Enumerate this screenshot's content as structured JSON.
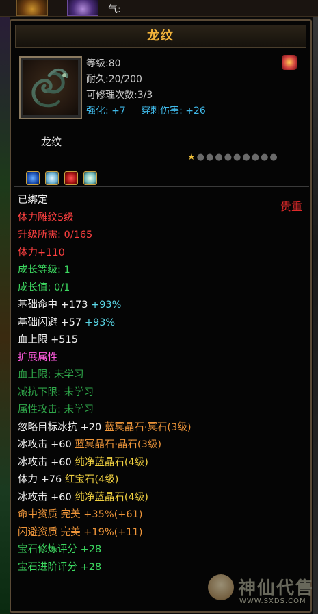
{
  "top": {
    "qi_label": "气:"
  },
  "item": {
    "title": "龙纹",
    "subname": "龙纹",
    "level": "等级:80",
    "durability": "耐久:20/200",
    "repairs": "可修理次数:3/3",
    "enhance_label": "强化:",
    "enhance_value": "+7",
    "pierce_label": "穿刺伤害:",
    "pierce_value": "+26",
    "stars_filled": 1,
    "stars_total": 10,
    "weight": "贵重",
    "gems": [
      "blue-gem-icon",
      "white-gem-icon",
      "red-gem-icon",
      "white-gem-icon"
    ]
  },
  "attributes": [
    {
      "text": "已绑定",
      "color": "white"
    },
    {
      "text": "体力雕纹5级",
      "color": "red"
    },
    {
      "text": "升级所需: 0/165",
      "color": "red"
    },
    {
      "text": "体力+110",
      "color": "red"
    },
    {
      "text": "成长等级: 1",
      "color": "green"
    },
    {
      "text": "成长值: 0/1",
      "color": "green"
    },
    {
      "text": "基础命中 +173",
      "extra": "+93%",
      "color": "white",
      "extra_color": "cyan"
    },
    {
      "text": "基础闪避 +57",
      "extra": "+93%",
      "color": "white",
      "extra_color": "cyan"
    },
    {
      "text": "血上限 +515",
      "color": "white"
    },
    {
      "text": "扩展属性",
      "color": "pink"
    },
    {
      "text": "血上限: 未学习",
      "color": "dgreen"
    },
    {
      "text": "减抗下限: 未学习",
      "color": "dgreen"
    },
    {
      "text": "属性攻击: 未学习",
      "color": "dgreen"
    },
    {
      "text": "忽略目标冰抗 +20",
      "extra": "蓝冥晶石·冥石(3级)",
      "color": "white",
      "extra_color": "orange"
    },
    {
      "text": "冰攻击 +60",
      "extra": "蓝冥晶石·晶石(3级)",
      "color": "white",
      "extra_color": "orange"
    },
    {
      "text": "冰攻击 +60",
      "extra": "纯净蓝晶石(4级)",
      "color": "white",
      "extra_color": "yellow"
    },
    {
      "text": "体力 +76",
      "extra": "红宝石(4级)",
      "color": "white",
      "extra_color": "yellow"
    },
    {
      "text": "冰攻击 +60",
      "extra": "纯净蓝晶石(4级)",
      "color": "white",
      "extra_color": "yellow"
    },
    {
      "text": "命中资质  完美",
      "extra": "+35%(+61)",
      "color": "orange",
      "extra_color": "orange"
    },
    {
      "text": "闪避资质  完美",
      "extra": "+19%(+11)",
      "color": "orange",
      "extra_color": "orange"
    },
    {
      "text": "宝石修炼评分 +28",
      "color": "green"
    },
    {
      "text": "宝石进阶评分 +28",
      "color": "green"
    }
  ],
  "watermark": {
    "brand": "神仙代售",
    "url": "WWW.SXDS.COM"
  }
}
